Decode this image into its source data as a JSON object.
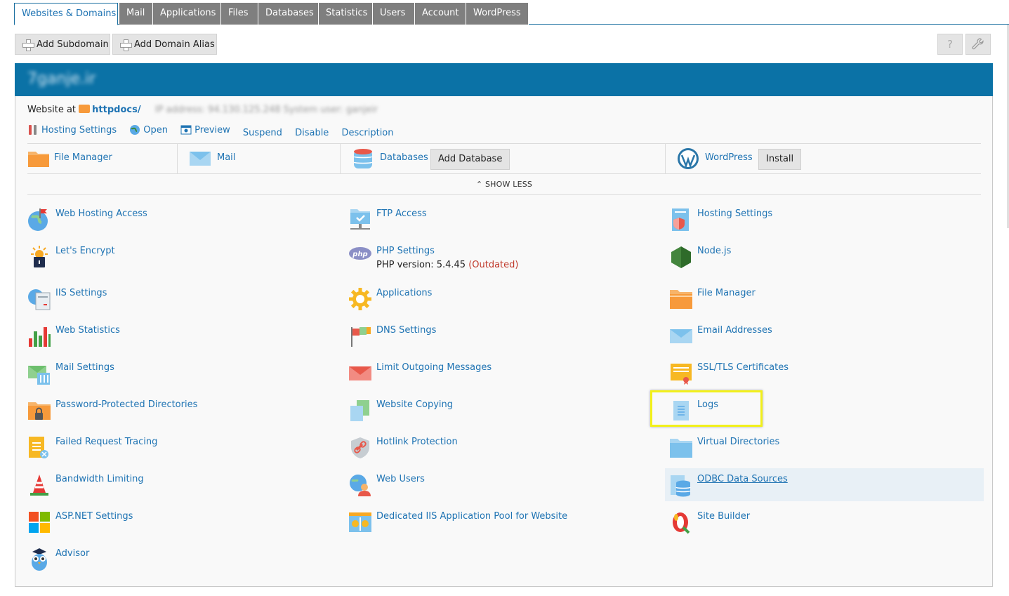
{
  "tabs": [
    "Websites & Domains",
    "Mail",
    "Applications",
    "Files",
    "Databases",
    "Statistics",
    "Users",
    "Account",
    "WordPress"
  ],
  "toolbar": {
    "add_subdomain": "Add Subdomain",
    "add_domain_alias": "Add Domain Alias",
    "help_glyph": "?",
    "tools_glyph": "🔧"
  },
  "domain": {
    "name": "7ganje.ir",
    "website_at": "Website at",
    "docroot": "httpdocs/",
    "ip_info": "IP address: 94.130.125.248    System user: ganjeir"
  },
  "actions": [
    "Hosting Settings",
    "Open",
    "Preview",
    "Suspend",
    "Disable",
    "Description"
  ],
  "quick": {
    "file_manager": "File Manager",
    "mail": "Mail",
    "databases": "Databases",
    "add_database": "Add Database",
    "wordpress": "WordPress",
    "install": "Install"
  },
  "show_less": "SHOW LESS",
  "tools": {
    "col1": [
      "Web Hosting Access",
      "Let's Encrypt",
      "IIS Settings",
      "Web Statistics",
      "Mail Settings",
      "Password-Protected Directories",
      "Failed Request Tracing",
      "Bandwidth Limiting",
      "ASP.NET Settings",
      "Advisor"
    ],
    "col2": [
      "FTP Access",
      "PHP Settings",
      "Applications",
      "DNS Settings",
      "Limit Outgoing Messages",
      "Website Copying",
      "Hotlink Protection",
      "Web Users",
      "Dedicated IIS Application Pool for Website"
    ],
    "col3": [
      "Hosting Settings",
      "Node.js",
      "File Manager",
      "Email Addresses",
      "SSL/TLS Certificates",
      "Logs",
      "Virtual Directories",
      "ODBC Data Sources",
      "Site Builder"
    ]
  },
  "php": {
    "version_label": "PHP version: 5.4.45",
    "status": "(Outdated)"
  },
  "colors": {
    "accent": "#0b72a6",
    "link": "#1e73b3",
    "tab_inactive": "#7f7f7f",
    "highlight": "#f2f01a",
    "outdated": "#c0392b"
  }
}
